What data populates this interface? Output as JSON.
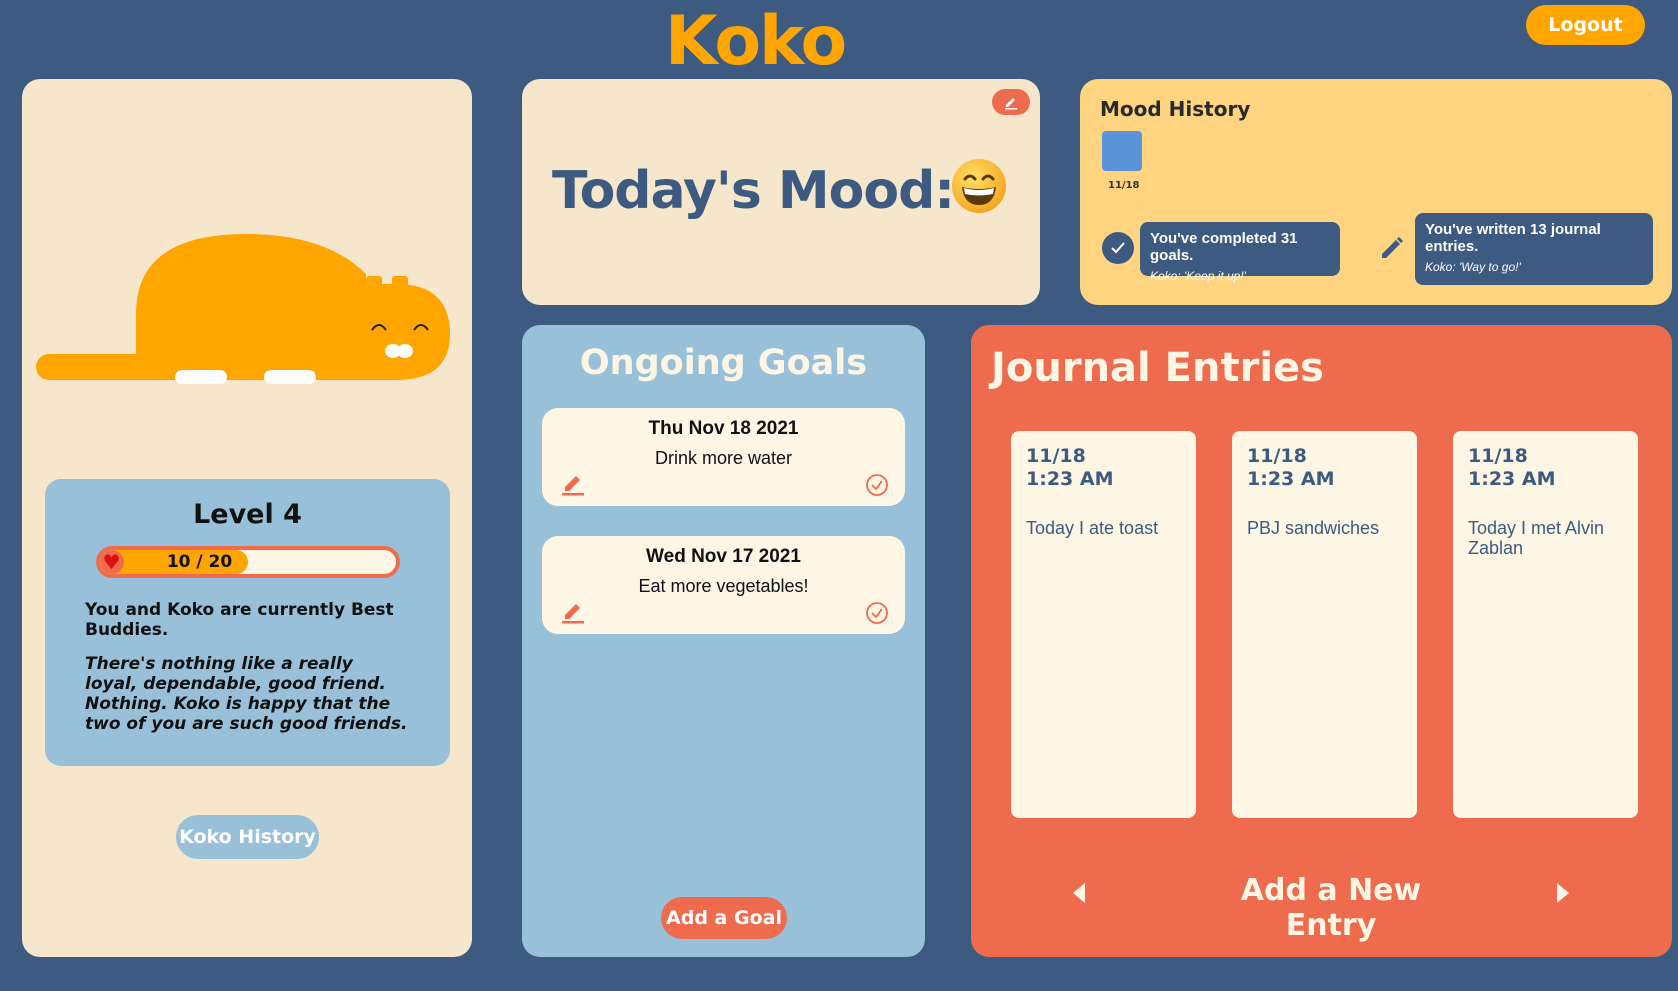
{
  "header": {
    "logo": "Koko",
    "logout_label": "Logout"
  },
  "pet_panel": {
    "level_label": "Level 4",
    "xp": {
      "current": 10,
      "max": 20,
      "text": "10 / 20"
    },
    "relationship_text": "You and Koko are currently Best Buddies.",
    "relationship_quote": "There's nothing like a really loyal, dependable, good friend. Nothing. Koko is happy that the two of you are such good friends.",
    "history_button": "Koko History"
  },
  "mood": {
    "title": "Today's Mood:",
    "emoji": "grinning-face"
  },
  "mood_history": {
    "title": "Mood History",
    "entries": [
      {
        "date": "11/18",
        "color": "#5b93d8"
      }
    ],
    "goals_stat": {
      "main": "You've completed 31 goals.",
      "sub": "Koko: 'Keep it up!'"
    },
    "journal_stat": {
      "main": "You've written 13 journal entries.",
      "sub": "Koko: 'Way to go!'"
    }
  },
  "goals": {
    "title": "Ongoing Goals",
    "items": [
      {
        "date": "Thu Nov 18 2021",
        "text": "Drink more water"
      },
      {
        "date": "Wed Nov 17 2021",
        "text": "Eat more vegetables!"
      }
    ],
    "add_button": "Add a Goal"
  },
  "journal": {
    "title": "Journal Entries",
    "entries": [
      {
        "date": "11/18",
        "time": "1:23 AM",
        "text": "Today I ate toast"
      },
      {
        "date": "11/18",
        "time": "1:23 AM",
        "text": "PBJ sandwiches"
      },
      {
        "date": "11/18",
        "time": "1:23 AM",
        "text": "Today I met Alvin Zablan"
      }
    ],
    "add_button": "Add a New Entry"
  },
  "colors": {
    "background": "#3d5a80",
    "orange": "#ffa500",
    "coral": "#ee6c4d",
    "cream": "#f6e6cc",
    "blue": "#98c1d9",
    "yellow": "#fed480"
  }
}
